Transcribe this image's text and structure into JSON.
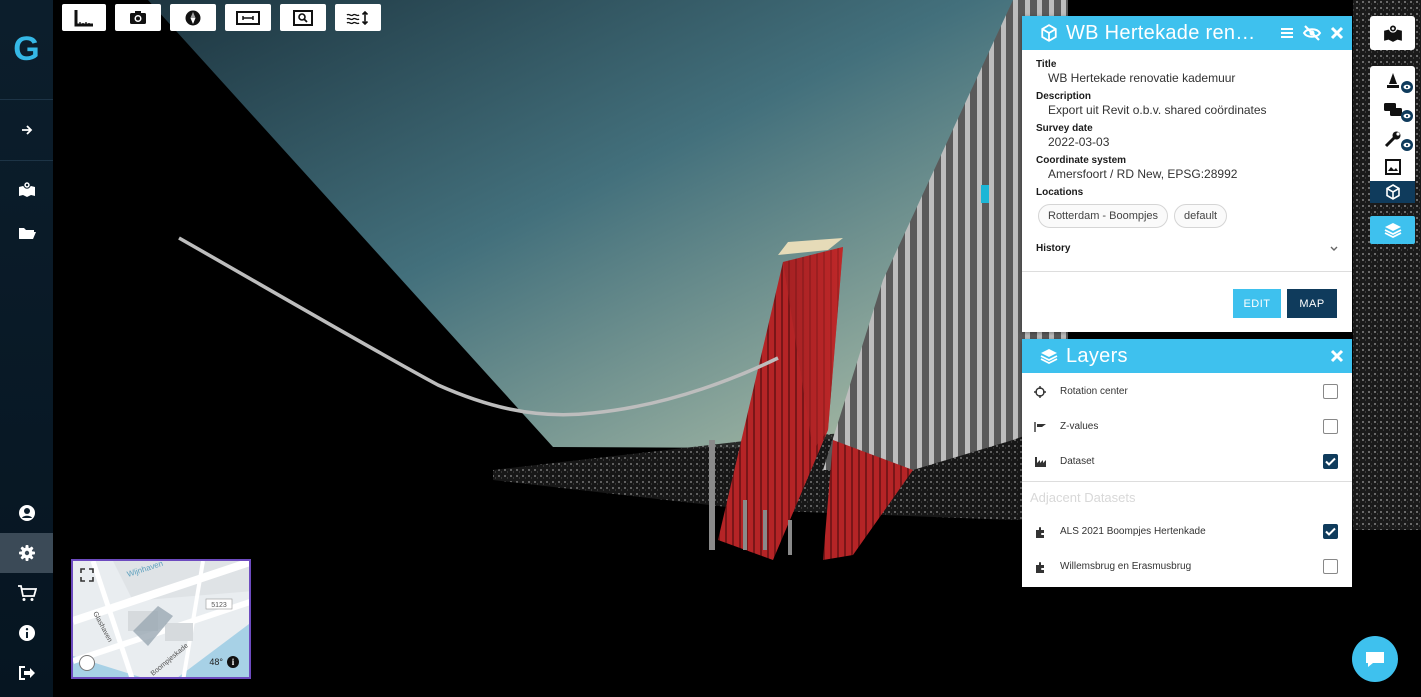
{
  "toolbar": {
    "tools": [
      "measure-icon",
      "camera-icon",
      "compass-icon",
      "ruler-icon",
      "zoom-extent-icon",
      "height-icon"
    ]
  },
  "sidebar": {
    "logo": "G",
    "items": [
      "arrow-right-icon",
      "map-layers-icon",
      "folder-icon"
    ],
    "bottom_items": [
      "user-icon",
      "gear-icon",
      "cart-icon",
      "info-icon",
      "sign-out-icon"
    ]
  },
  "info_panel": {
    "title": "WB Hertekade ren…",
    "fields": {
      "title_label": "Title",
      "title_value": "WB Hertekade renovatie kademuur",
      "description_label": "Description",
      "description_value": "Export uit Revit o.b.v. shared coördinates",
      "survey_date_label": "Survey date",
      "survey_date_value": "2022-03-03",
      "coordinate_system_label": "Coordinate system",
      "coordinate_system_value": "Amersfoort / RD New, EPSG:28992",
      "locations_label": "Locations"
    },
    "locations": [
      "Rotterdam - Boompjes",
      "default"
    ],
    "history_label": "History",
    "edit_label": "EDIT",
    "map_label": "MAP"
  },
  "layers_panel": {
    "title": "Layers",
    "rows": [
      {
        "label": "Rotation center",
        "checked": false
      },
      {
        "label": "Z-values",
        "checked": false
      },
      {
        "label": "Dataset",
        "checked": true
      }
    ],
    "adjacent_heading": "Adjacent Datasets",
    "adjacent": [
      {
        "label": "ALS 2021 Boompjes Hertenkade",
        "checked": true
      },
      {
        "label": "Willemsbrug en Erasmusbrug",
        "checked": false
      }
    ]
  },
  "minimap": {
    "heading": "48°",
    "road_label": "5123",
    "street_labels": [
      "Wijnhaven",
      "Glashaven",
      "Boompjeskade"
    ]
  },
  "colors": {
    "accent": "#3ec1ee",
    "dark": "#0f3b5c",
    "sidebar": "#0c1e2c"
  }
}
